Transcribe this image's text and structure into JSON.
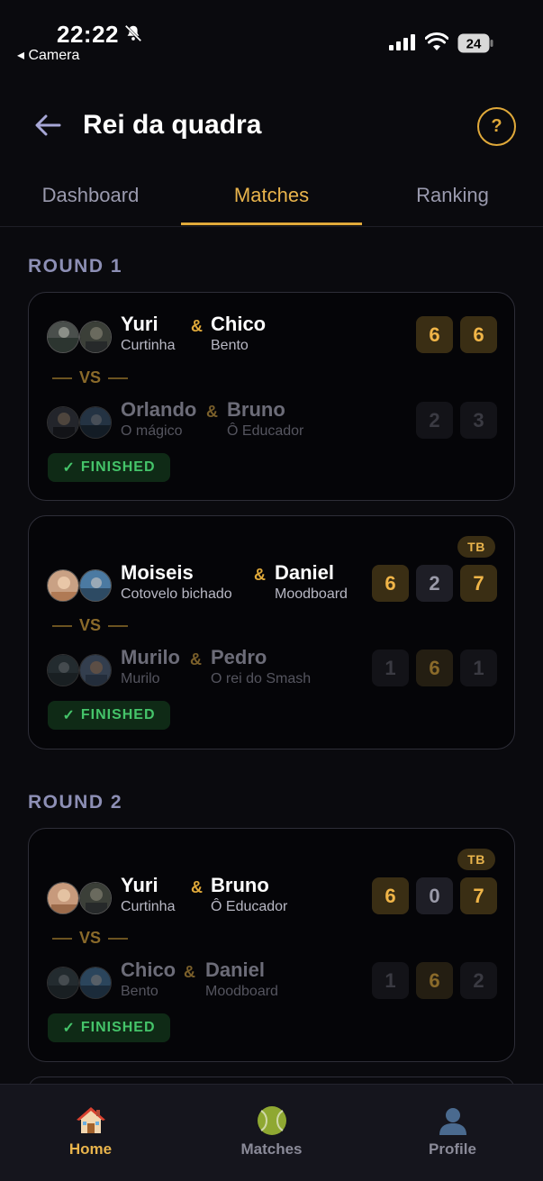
{
  "status_bar": {
    "time": "22:22",
    "back_app": "◂ Camera",
    "battery": "24"
  },
  "header": {
    "title": "Rei da quadra",
    "help": "?"
  },
  "tabs": [
    {
      "label": "Dashboard",
      "active": false
    },
    {
      "label": "Matches",
      "active": true
    },
    {
      "label": "Ranking",
      "active": false
    }
  ],
  "rounds": [
    {
      "label": "ROUND 1",
      "matches": [
        {
          "tiebreak": null,
          "team1": {
            "p1": {
              "name": "Yuri",
              "nick": "Curtinha"
            },
            "p2": {
              "name": "Chico",
              "nick": "Bento"
            },
            "scores": [
              6,
              6
            ]
          },
          "vs": "VS",
          "team2": {
            "p1": {
              "name": "Orlando",
              "nick": "O mágico"
            },
            "p2": {
              "name": "Bruno",
              "nick": "Ô Educador"
            },
            "scores": [
              2,
              3
            ]
          },
          "status": "FINISHED"
        },
        {
          "tiebreak": "TB",
          "team1": {
            "p1": {
              "name": "Moiseis",
              "nick": "Cotovelo bichado"
            },
            "p2": {
              "name": "Daniel",
              "nick": "Moodboard"
            },
            "scores": [
              6,
              2,
              7
            ]
          },
          "vs": "VS",
          "team2": {
            "p1": {
              "name": "Murilo",
              "nick": "Murilo"
            },
            "p2": {
              "name": "Pedro",
              "nick": "O rei do Smash"
            },
            "scores": [
              1,
              6,
              1
            ]
          },
          "status": "FINISHED"
        }
      ]
    },
    {
      "label": "ROUND 2",
      "matches": [
        {
          "tiebreak": "TB",
          "team1": {
            "p1": {
              "name": "Yuri",
              "nick": "Curtinha"
            },
            "p2": {
              "name": "Bruno",
              "nick": "Ô Educador"
            },
            "scores": [
              6,
              0,
              7
            ]
          },
          "vs": "VS",
          "team2": {
            "p1": {
              "name": "Chico",
              "nick": "Bento"
            },
            "p2": {
              "name": "Daniel",
              "nick": "Moodboard"
            },
            "scores": [
              1,
              6,
              2
            ]
          },
          "status": "FINISHED"
        }
      ]
    }
  ],
  "amp": "&",
  "check": "✓",
  "bottom_nav": [
    {
      "label": "Home",
      "icon": "house-icon",
      "active": true
    },
    {
      "label": "Matches",
      "icon": "tennis-ball-icon",
      "active": false
    },
    {
      "label": "Profile",
      "icon": "profile-icon",
      "active": false
    }
  ],
  "colors": {
    "accent": "#e0a93a",
    "finished": "#45c46a",
    "background": "#0a0a0e"
  }
}
